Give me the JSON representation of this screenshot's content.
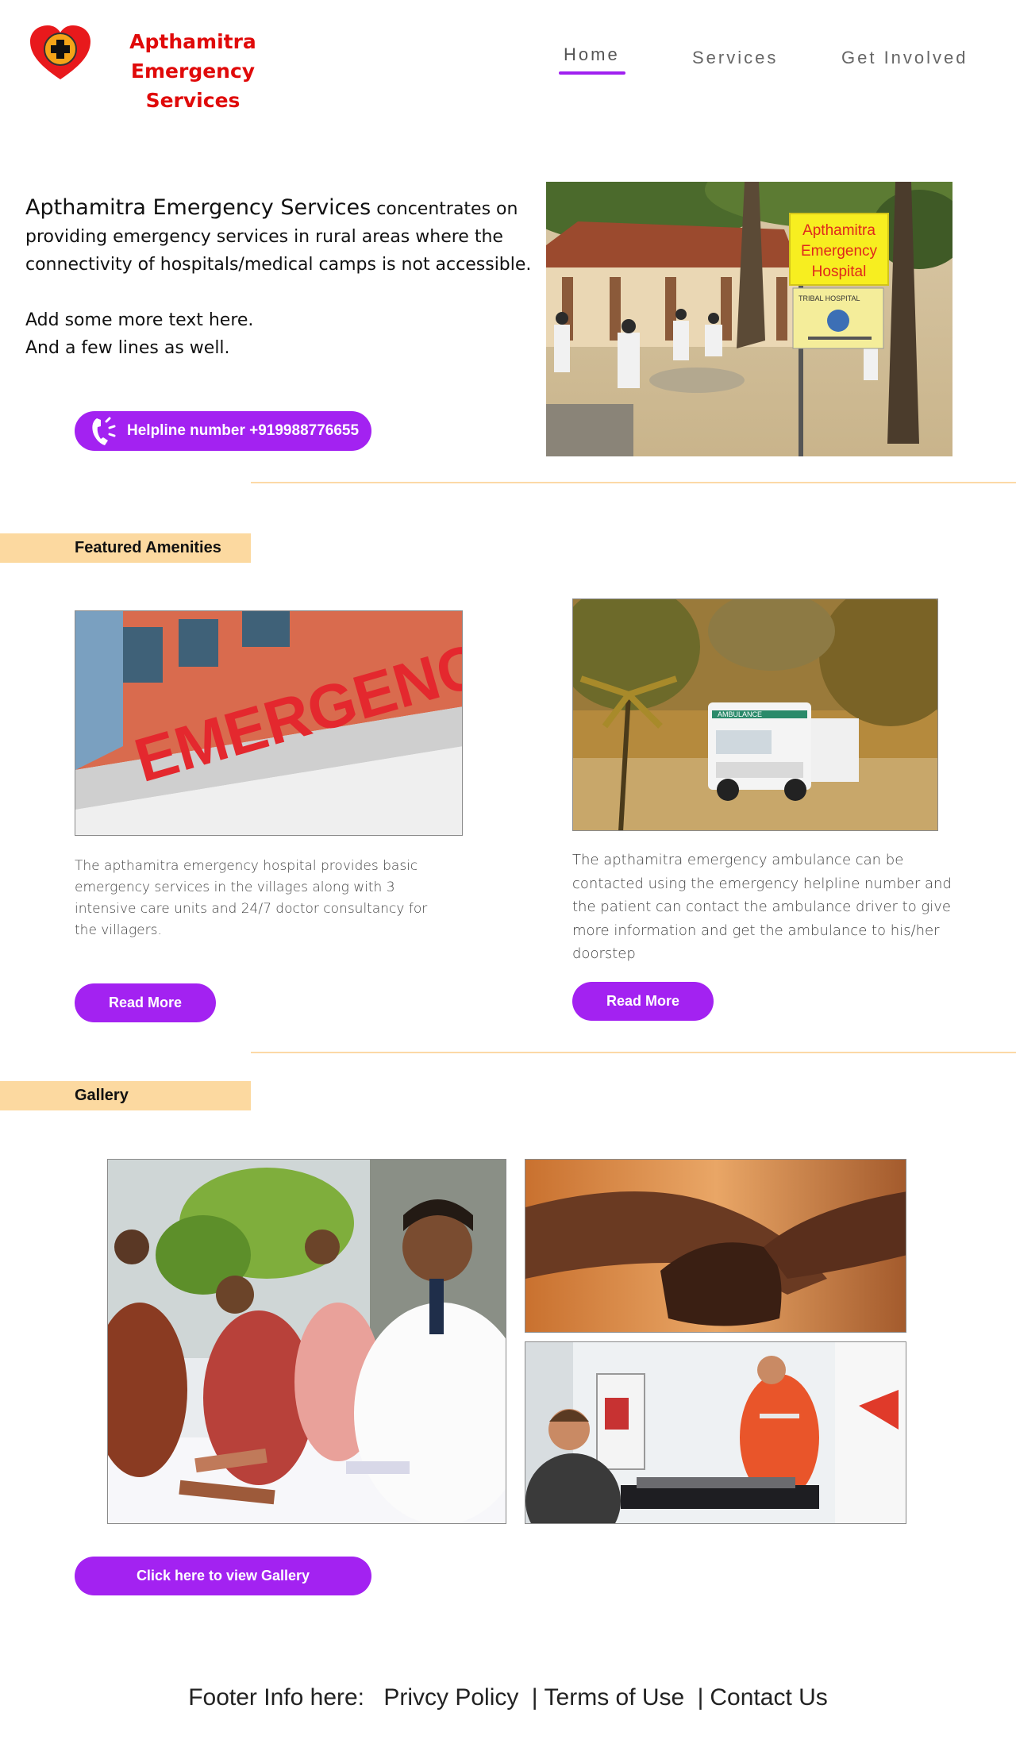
{
  "header": {
    "brand_line1": "Apthamitra",
    "brand_line2": "Emergency Services",
    "nav": [
      {
        "label": "Home",
        "active": true
      },
      {
        "label": "Services",
        "active": false
      },
      {
        "label": "Get Involved",
        "active": false
      }
    ]
  },
  "intro": {
    "brand": "Apthamitra Emergency Services",
    "text": " concentrates on providing emergency services in rural areas where the connectivity of hospitals/medical camps is not accessible.",
    "extra_line1": "Add some more text here.",
    "extra_line2": "And a few lines as well.",
    "helpline_label": "Helpline number +919988776655"
  },
  "hero_photo": {
    "sign_line1": "Apthamitra",
    "sign_line2": "Emergency",
    "sign_line3": "Hospital",
    "board_text": "TRIBAL HOSPITAL"
  },
  "amenities": {
    "section_label": "Featured Amenities",
    "items": [
      {
        "image_text": "EMERGENCY",
        "description": "The apthamitra emergency hospital provides basic emergency services in the villages along with 3 intensive care units and 24/7 doctor consultancy for the villagers.",
        "button": "Read More"
      },
      {
        "image_text": "AMBULANCE",
        "description": "The apthamitra emergency ambulance can be contacted using the emergency helpline number and the patient can contact the ambulance driver to give more information and get the ambulance to his/her doorstep",
        "button": "Read More"
      }
    ]
  },
  "gallery": {
    "section_label": "Gallery",
    "button": "Click here to view Gallery"
  },
  "footer": {
    "lead": "Footer Info here:",
    "links": [
      "Privcy Policy",
      "Terms of Use",
      "Contact Us"
    ],
    "separator": "|"
  },
  "colors": {
    "accent": "#a322f1",
    "brand_red": "#e00a0a",
    "section_band": "#fcd9a0",
    "divider": "#fcd9a6"
  }
}
